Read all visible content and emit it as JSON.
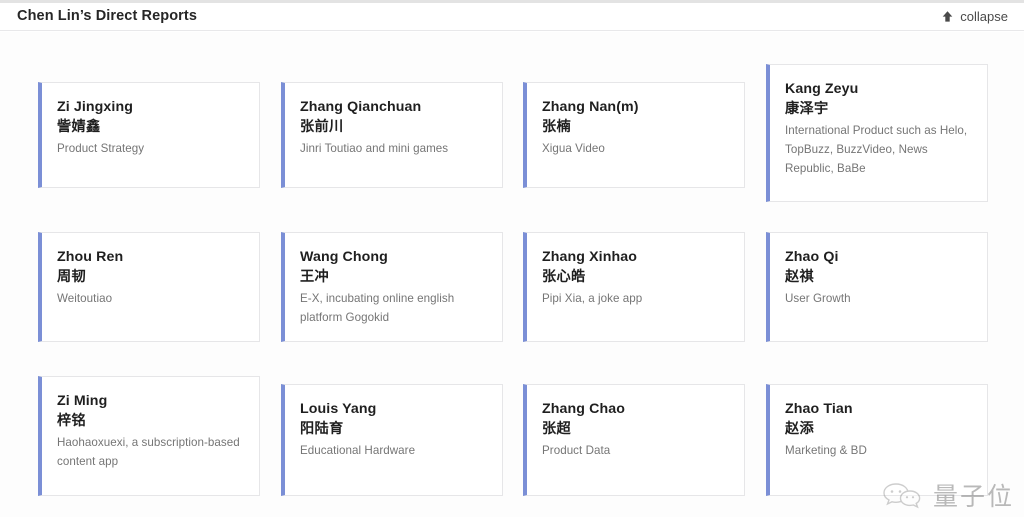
{
  "header": {
    "title": "Chen Lin’s Direct Reports",
    "collapse_label": "collapse",
    "collapse_icon": "arrow-up-icon"
  },
  "theme": {
    "accent_color": "#7b8fd6",
    "card_bg": "#ffffff",
    "card_border": "#e6e6e8",
    "page_bg": "#fdfdfd",
    "title_color": "#1f1f1f",
    "role_color": "#757575"
  },
  "cards": [
    {
      "name_en": "Zi Jingxing",
      "name_cn": "訾婧鑫",
      "role": "Product Strategy"
    },
    {
      "name_en": "Zhang Qianchuan",
      "name_cn": "张前川",
      "role": "Jinri Toutiao and mini games"
    },
    {
      "name_en": "Zhang Nan(m)",
      "name_cn": "张楠",
      "role": "Xigua Video"
    },
    {
      "name_en": "Kang Zeyu",
      "name_cn": "康泽宇",
      "role": "International Product such as Helo, TopBuzz, BuzzVideo, News Republic, BaBe"
    },
    {
      "name_en": "Zhou Ren",
      "name_cn": "周韧",
      "role": "Weitoutiao"
    },
    {
      "name_en": "Wang Chong",
      "name_cn": "王冲",
      "role": "E-X, incubating online english platform Gogokid"
    },
    {
      "name_en": "Zhang Xinhao",
      "name_cn": "张心皓",
      "role": "Pipi Xia, a joke app"
    },
    {
      "name_en": "Zhao Qi",
      "name_cn": "赵祺",
      "role": "User Growth"
    },
    {
      "name_en": "Zi Ming",
      "name_cn": "梓铭",
      "role": "Haohaoxuexi, a subscription-based content app"
    },
    {
      "name_en": "Louis Yang",
      "name_cn": "阳陆育",
      "role": "Educational Hardware"
    },
    {
      "name_en": "Zhang Chao",
      "name_cn": "张超",
      "role": "Product Data"
    },
    {
      "name_en": "Zhao Tian",
      "name_cn": "赵添",
      "role": "Marketing & BD"
    }
  ],
  "watermark": {
    "text": "量子位",
    "icon": "wechat-bubbles-icon"
  }
}
